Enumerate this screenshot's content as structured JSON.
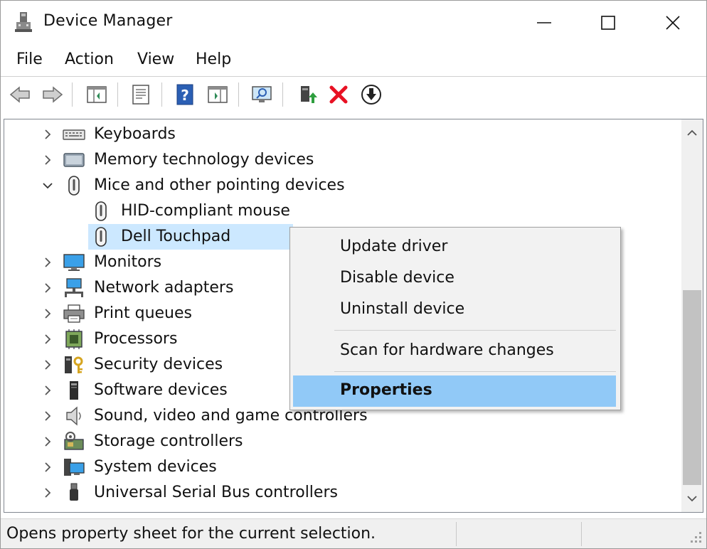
{
  "window": {
    "title": "Device Manager"
  },
  "menu": {
    "file": "File",
    "action": "Action",
    "view": "View",
    "help": "Help"
  },
  "toolbar": {
    "icons": [
      "back-arrow-icon",
      "forward-arrow-icon",
      "console-tree-icon",
      "properties-sheet-icon",
      "help-icon",
      "action-pane-icon",
      "scan-monitor-icon",
      "update-driver-icon",
      "uninstall-x-icon",
      "download-driver-icon"
    ]
  },
  "tree": {
    "items": [
      {
        "label": "Keyboards",
        "icon": "keyboard-icon",
        "expanded": false
      },
      {
        "label": "Memory technology devices",
        "icon": "memory-card-icon",
        "expanded": false
      },
      {
        "label": "Mice and other pointing devices",
        "icon": "mouse-icon",
        "expanded": true
      },
      {
        "label": "HID-compliant mouse",
        "icon": "mouse-icon",
        "child": true
      },
      {
        "label": "Dell Touchpad",
        "icon": "mouse-icon",
        "child": true,
        "selected": true
      },
      {
        "label": "Monitors",
        "icon": "monitor-icon",
        "expanded": false
      },
      {
        "label": "Network adapters",
        "icon": "network-icon",
        "expanded": false
      },
      {
        "label": "Print queues",
        "icon": "printer-icon",
        "expanded": false
      },
      {
        "label": "Processors",
        "icon": "processor-icon",
        "expanded": false
      },
      {
        "label": "Security devices",
        "icon": "security-key-icon",
        "expanded": false
      },
      {
        "label": "Software devices",
        "icon": "software-device-icon",
        "expanded": false
      },
      {
        "label": "Sound, video and game controllers",
        "icon": "speaker-icon",
        "expanded": false
      },
      {
        "label": "Storage controllers",
        "icon": "storage-controller-icon",
        "expanded": false
      },
      {
        "label": "System devices",
        "icon": "system-device-icon",
        "expanded": false
      },
      {
        "label": "Universal Serial Bus controllers",
        "icon": "usb-icon",
        "expanded": false
      }
    ]
  },
  "context_menu": {
    "update_driver": "Update driver",
    "disable_device": "Disable device",
    "uninstall_device": "Uninstall device",
    "scan_hardware": "Scan for hardware changes",
    "properties": "Properties"
  },
  "status": {
    "text": "Opens property sheet for the current selection."
  },
  "colors": {
    "selection": "#cce8ff",
    "menu_highlight": "#91c9f7",
    "delete_red": "#e81123",
    "help_blue": "#2b5fb4"
  }
}
